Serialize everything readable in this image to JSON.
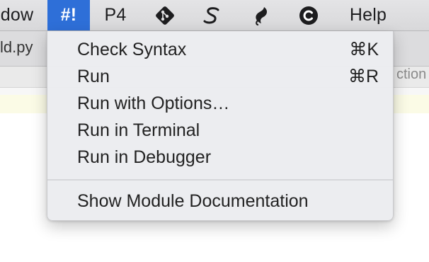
{
  "menubar": {
    "items": [
      {
        "label": "dow"
      },
      {
        "label": "#!"
      },
      {
        "label": "P4"
      },
      {
        "label": "Help"
      }
    ],
    "icons": [
      "git-icon",
      "subversion-icon",
      "mercurial-icon",
      "copyright-c-icon"
    ]
  },
  "editor": {
    "tab_label": "ld.py",
    "function_label": "ction"
  },
  "menu": {
    "items": [
      {
        "label": "Check Syntax",
        "shortcut": "⌘K"
      },
      {
        "label": "Run",
        "shortcut": "⌘R"
      },
      {
        "label": "Run with Options…",
        "shortcut": ""
      },
      {
        "label": "Run in Terminal",
        "shortcut": ""
      },
      {
        "label": "Run in Debugger",
        "shortcut": ""
      },
      {
        "label": "Show Module Documentation",
        "shortcut": ""
      }
    ]
  },
  "colors": {
    "active_menu": "#2e6fd8",
    "menu_background": "#ecedf0"
  }
}
